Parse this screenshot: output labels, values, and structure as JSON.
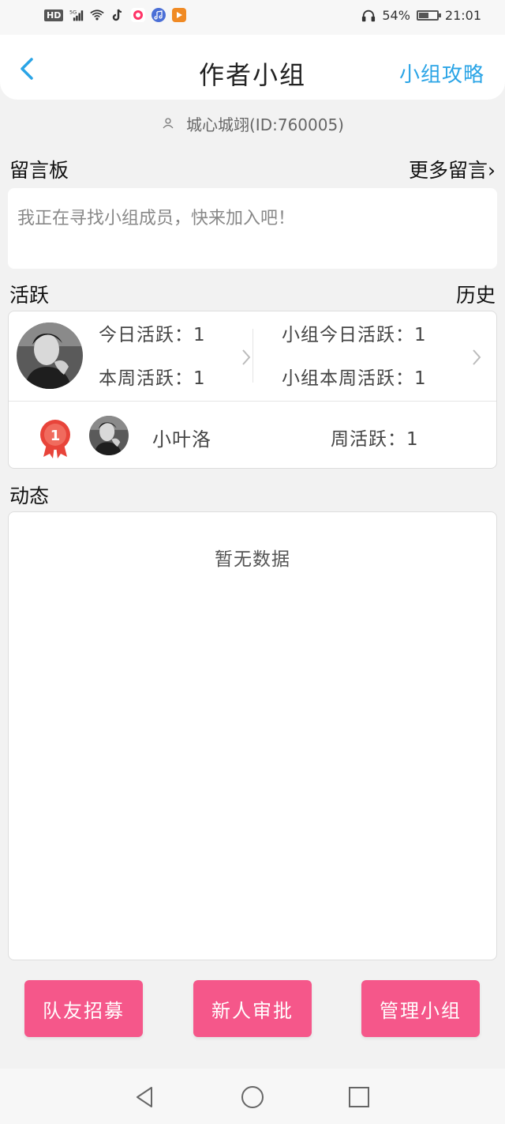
{
  "status_bar": {
    "network_label": "HD",
    "signal_label": "5G",
    "battery_text": "54%",
    "battery_level": 0.54,
    "time": "21:01"
  },
  "header": {
    "title": "作者小组",
    "right_link": "小组攻略"
  },
  "owner_line": "城心城翊(ID:760005)",
  "board": {
    "title": "留言板",
    "more_link": "更多留言›",
    "placeholder": "我正在寻找小组成员，快来加入吧！"
  },
  "activity": {
    "title": "活跃",
    "history_link": "历史",
    "today_personal": "今日活跃：1",
    "week_personal": "本周活跃：1",
    "today_group": "小组今日活跃：1",
    "week_group": "小组本周活跃：1",
    "rank_badge": "1",
    "member_name": "小叶洛",
    "member_weekly": "周活跃：1"
  },
  "feed": {
    "title": "动态",
    "empty_text": "暂无数据"
  },
  "actions": {
    "recruit": "队友招募",
    "approve": "新人审批",
    "manage": "管理小组"
  },
  "colors": {
    "accent_blue": "#2aa4e6",
    "action_pink": "#f5578a",
    "medal_red": "#e8443a"
  }
}
